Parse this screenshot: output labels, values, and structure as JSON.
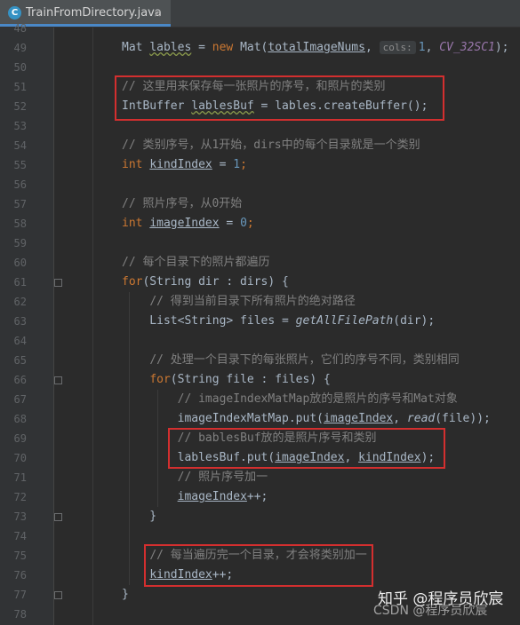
{
  "tab": {
    "icon": "java-class-icon",
    "title": "TrainFromDirectory.java",
    "close": "×"
  },
  "lines": [
    {
      "num": "48"
    },
    {
      "num": "49",
      "tokens": [
        {
          "t": "Mat "
        },
        {
          "t": "lables",
          "c": "sq"
        },
        {
          "t": " = "
        },
        {
          "t": "new",
          "c": "kw"
        },
        {
          "t": " Mat("
        },
        {
          "t": "totalImageNums",
          "c": "ul"
        },
        {
          "t": ", "
        },
        {
          "hint": "cols:"
        },
        {
          "t": "1",
          "c": "num"
        },
        {
          "t": ", "
        },
        {
          "t": "CV_32SC1",
          "c": "const"
        },
        {
          "t": ");"
        }
      ]
    },
    {
      "num": "50"
    },
    {
      "num": "51",
      "tokens": [
        {
          "t": "// 这里用来保存每一张照片的序号，和照片的类别",
          "c": "cm"
        }
      ]
    },
    {
      "num": "52",
      "tokens": [
        {
          "t": "IntBuffer "
        },
        {
          "t": "lablesBuf",
          "c": "sq"
        },
        {
          "t": " = lables.createBuffer();"
        }
      ]
    },
    {
      "num": "53"
    },
    {
      "num": "54",
      "tokens": [
        {
          "t": "// 类别序号，从1开始，dirs中的每个目录就是一个类别",
          "c": "cm"
        }
      ]
    },
    {
      "num": "55",
      "tokens": [
        {
          "t": "int",
          "c": "kw"
        },
        {
          "t": " "
        },
        {
          "t": "kindIndex",
          "c": "ul"
        },
        {
          "t": " = "
        },
        {
          "t": "1",
          "c": "num"
        },
        {
          "t": ";",
          "c": "kw"
        }
      ]
    },
    {
      "num": "56"
    },
    {
      "num": "57",
      "tokens": [
        {
          "t": "// 照片序号，从0开始",
          "c": "cm"
        }
      ]
    },
    {
      "num": "58",
      "tokens": [
        {
          "t": "int",
          "c": "kw"
        },
        {
          "t": " "
        },
        {
          "t": "imageIndex",
          "c": "ul"
        },
        {
          "t": " = "
        },
        {
          "t": "0",
          "c": "num"
        },
        {
          "t": ";",
          "c": "kw"
        }
      ]
    },
    {
      "num": "59"
    },
    {
      "num": "60",
      "tokens": [
        {
          "t": "// 每个目录下的照片都遍历",
          "c": "cm"
        }
      ]
    },
    {
      "num": "61",
      "tokens": [
        {
          "t": "for",
          "c": "kw"
        },
        {
          "t": "(String dir : dirs) {"
        }
      ]
    },
    {
      "num": "62",
      "tokens": [
        {
          "t": "    "
        },
        {
          "t": "// 得到当前目录下所有照片的绝对路径",
          "c": "cm"
        }
      ]
    },
    {
      "num": "63",
      "tokens": [
        {
          "t": "    List<String> files = "
        },
        {
          "t": "getAllFilePath",
          "c": "it"
        },
        {
          "t": "(dir);"
        }
      ]
    },
    {
      "num": "64"
    },
    {
      "num": "65",
      "tokens": [
        {
          "t": "    "
        },
        {
          "t": "// 处理一个目录下的每张照片，它们的序号不同，类别相同",
          "c": "cm"
        }
      ]
    },
    {
      "num": "66",
      "tokens": [
        {
          "t": "    "
        },
        {
          "t": "for",
          "c": "kw"
        },
        {
          "t": "(String file : files) {"
        }
      ]
    },
    {
      "num": "67",
      "tokens": [
        {
          "t": "        "
        },
        {
          "t": "// imageIndexMatMap放的是照片的序号和Mat对象",
          "c": "cm"
        }
      ]
    },
    {
      "num": "68",
      "tokens": [
        {
          "t": "        imageIndexMatMap.put("
        },
        {
          "t": "imageIndex",
          "c": "ul"
        },
        {
          "t": ", "
        },
        {
          "t": "read",
          "c": "it"
        },
        {
          "t": "(file));"
        }
      ]
    },
    {
      "num": "69",
      "tokens": [
        {
          "t": "        "
        },
        {
          "t": "// bablesBuf放的是照片序号和类别",
          "c": "cm"
        }
      ]
    },
    {
      "num": "70",
      "tokens": [
        {
          "t": "        lablesBuf.put("
        },
        {
          "t": "imageIndex",
          "c": "ul"
        },
        {
          "t": ", "
        },
        {
          "t": "kindIndex",
          "c": "ul"
        },
        {
          "t": ");"
        }
      ]
    },
    {
      "num": "71",
      "tokens": [
        {
          "t": "        "
        },
        {
          "t": "// 照片序号加一",
          "c": "cm"
        }
      ]
    },
    {
      "num": "72",
      "tokens": [
        {
          "t": "        "
        },
        {
          "t": "imageIndex",
          "c": "ul"
        },
        {
          "t": "++;"
        }
      ]
    },
    {
      "num": "73",
      "tokens": [
        {
          "t": "    }"
        }
      ]
    },
    {
      "num": "74"
    },
    {
      "num": "75",
      "tokens": [
        {
          "t": "    "
        },
        {
          "t": "// 每当遍历完一个目录，才会将类别加一",
          "c": "cm"
        }
      ]
    },
    {
      "num": "76",
      "tokens": [
        {
          "t": "    "
        },
        {
          "t": "kindIndex",
          "c": "ul"
        },
        {
          "t": "++;"
        }
      ]
    },
    {
      "num": "77",
      "tokens": [
        {
          "t": "}"
        }
      ]
    },
    {
      "num": "78"
    }
  ],
  "watermark": "知乎 @程序员欣宸",
  "watermark_secondary": "CSDN @程序员欣宸"
}
